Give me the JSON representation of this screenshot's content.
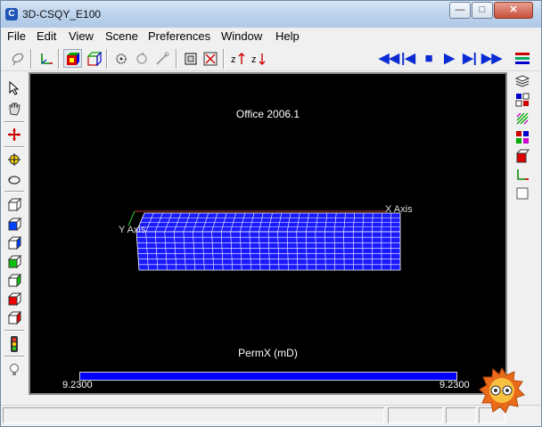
{
  "window": {
    "title": "3D-CSQY_E100",
    "app_icon_glyph": "C",
    "controls": {
      "minimize": "—",
      "maximize": "□",
      "close": "✕"
    }
  },
  "menu": [
    "File",
    "Edit",
    "View",
    "Scene",
    "Preferences",
    "Window",
    "Help"
  ],
  "toolbar": {
    "icons": [
      "lasso-icon",
      "axes-icon",
      "color-cube-icon",
      "wire-cube-icon",
      "orbit-icon",
      "orbit-alt-icon",
      "wand-off-icon",
      "frame-icon",
      "fit-view-icon",
      "sort-z-asc-icon",
      "sort-z-desc-icon"
    ],
    "playback": {
      "rewind": "◀◀",
      "step_back": "|◀",
      "stop": "■",
      "play": "▶",
      "step_forward": "▶|",
      "fast_forward": "▶▶",
      "color": "#0a2bd3"
    }
  },
  "left_toolbar": [
    "pointer-icon",
    "hand-pan-icon",
    "move-red-icon",
    "move-yellow-icon",
    "rotate-icon",
    "cube-outline-icon",
    "cube-blue-icon",
    "cube-blue-face-icon",
    "cube-green-icon",
    "cube-green-face-icon",
    "cube-red-icon",
    "cube-red-face-icon",
    "traffic-light-icon",
    "bulb-icon"
  ],
  "right_toolbar": [
    "bars-stack-icon",
    "layers-icon",
    "grid-colors-icon",
    "mesh-icon",
    "cubes-colored-icon",
    "red-block-icon",
    "axes-small-icon",
    "blank-box-icon"
  ],
  "viewport": {
    "background": "#000000",
    "title": "Office 2006.1",
    "x_axis_label": "X Axis",
    "y_axis_label": "Y Axis",
    "legend": {
      "title": "PermX (mD)",
      "min": "9.2300",
      "max": "9.2300",
      "bar_color": "#0000ff"
    },
    "grid_color": "#1a1aff",
    "grid_line_color": "#ffffff"
  },
  "statusbar": {
    "panes": [
      "",
      "",
      "",
      ""
    ]
  }
}
